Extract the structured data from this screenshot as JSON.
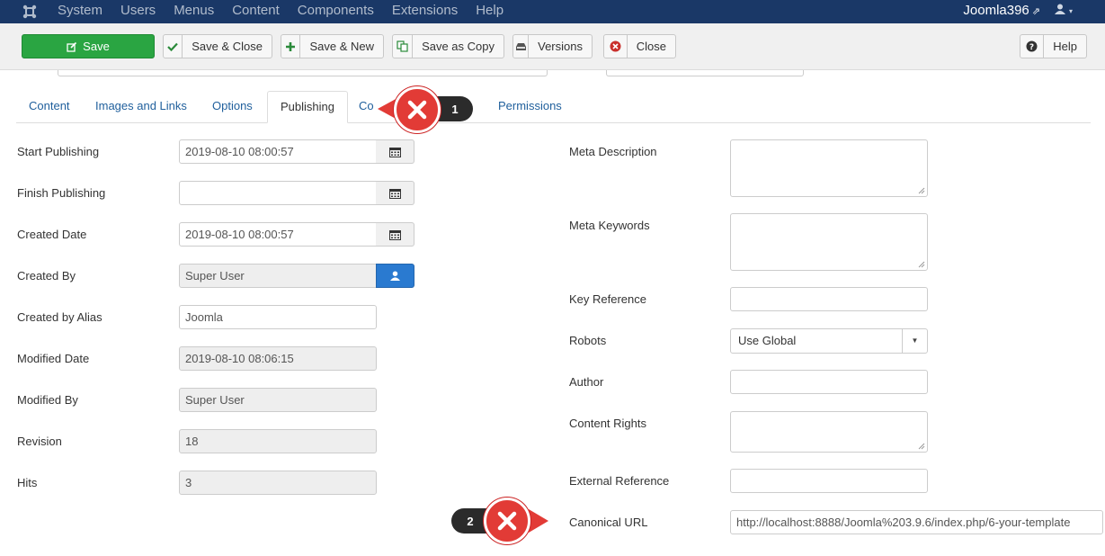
{
  "menubar": {
    "items": [
      "System",
      "Users",
      "Menus",
      "Content",
      "Components",
      "Extensions",
      "Help"
    ],
    "site_name": "Joomla396",
    "external_glyph": "⇗",
    "user_glyph": "▾"
  },
  "toolbar": {
    "save": "Save",
    "save_close": "Save & Close",
    "save_new": "Save & New",
    "save_copy": "Save as Copy",
    "versions": "Versions",
    "close": "Close",
    "help": "Help"
  },
  "tabs": [
    "Content",
    "Images and Links",
    "Options",
    "Publishing",
    "Co",
    "Permissions"
  ],
  "active_tab": "Publishing",
  "left_fields": {
    "start_publishing": {
      "label": "Start Publishing",
      "value": "2019-08-10 08:00:57"
    },
    "finish_publishing": {
      "label": "Finish Publishing",
      "value": ""
    },
    "created_date": {
      "label": "Created Date",
      "value": "2019-08-10 08:00:57"
    },
    "created_by": {
      "label": "Created By",
      "value": "Super User"
    },
    "created_by_alias": {
      "label": "Created by Alias",
      "value": "Joomla"
    },
    "modified_date": {
      "label": "Modified Date",
      "value": "2019-08-10 08:06:15"
    },
    "modified_by": {
      "label": "Modified By",
      "value": "Super User"
    },
    "revision": {
      "label": "Revision",
      "value": "18"
    },
    "hits": {
      "label": "Hits",
      "value": "3"
    }
  },
  "right_fields": {
    "meta_description": {
      "label": "Meta Description",
      "value": ""
    },
    "meta_keywords": {
      "label": "Meta Keywords",
      "value": ""
    },
    "key_reference": {
      "label": "Key Reference",
      "value": ""
    },
    "robots": {
      "label": "Robots",
      "value": "Use Global"
    },
    "author": {
      "label": "Author",
      "value": ""
    },
    "content_rights": {
      "label": "Content Rights",
      "value": ""
    },
    "external_reference": {
      "label": "External Reference",
      "value": ""
    },
    "canonical_url": {
      "label": "Canonical URL",
      "value": "http://localhost:8888/Joomla%203.9.6/index.php/6-your-template"
    }
  },
  "annotations": {
    "marker_1": "1",
    "marker_2": "2"
  },
  "colors": {
    "menubar_bg": "#1a3867",
    "save_green": "#2aa542",
    "marker_red": "#e23b36",
    "user_button_blue": "#2a7ad0",
    "link_blue": "#1f5f9c"
  }
}
